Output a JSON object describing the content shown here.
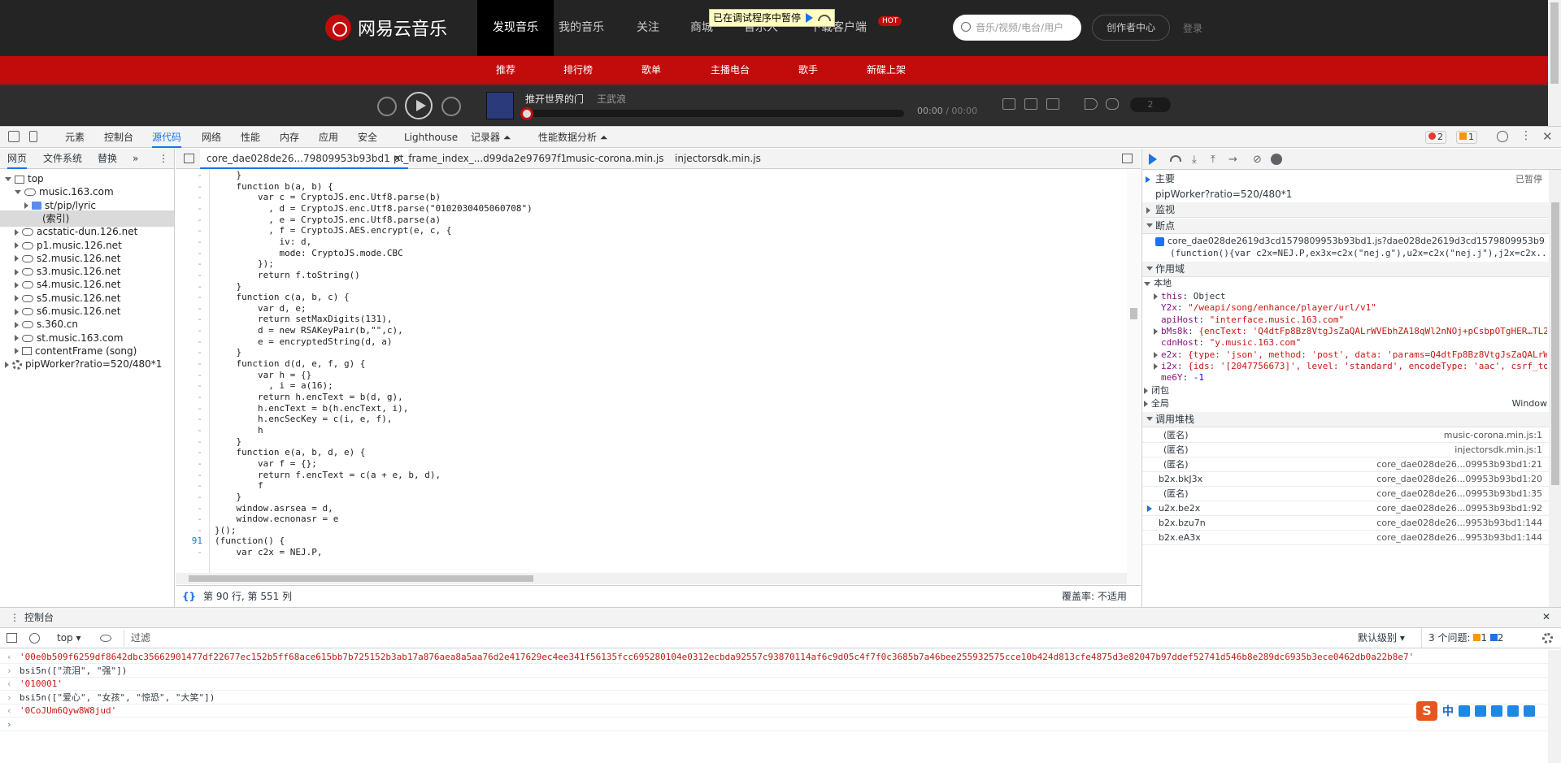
{
  "site": {
    "logo_text": "网易云音乐",
    "nav": [
      "发现音乐",
      "我的音乐",
      "关注",
      "商城",
      "音乐人",
      "下载客户端"
    ],
    "hot_badge": "HOT",
    "debugger_paused": "已在调试程序中暂停",
    "search_placeholder": "音乐/视频/电台/用户",
    "creator_center": "创作者中心",
    "login": "登录",
    "subnav": [
      "推荐",
      "排行榜",
      "歌单",
      "主播电台",
      "歌手",
      "新碟上架"
    ],
    "player": {
      "song": "推开世界的门",
      "artist": "王武浪",
      "time_current": "00:00",
      "time_total": "/ 00:00",
      "volume_count": "2",
      "progress_percent": 0
    }
  },
  "devtools": {
    "tabs": [
      "元素",
      "控制台",
      "源代码",
      "网络",
      "性能",
      "内存",
      "应用",
      "安全",
      "Lighthouse",
      "记录器 ⏶",
      "性能数据分析 ⏶"
    ],
    "errors": "2",
    "warnings": "1",
    "navigator_tabs": [
      "网页",
      "文件系统",
      "替换",
      "»"
    ],
    "tree": [
      {
        "label": "top",
        "icon": "frame-icon",
        "level": 0,
        "open": true
      },
      {
        "label": "music.163.com",
        "icon": "cloud-icon",
        "level": 1,
        "open": true
      },
      {
        "label": "st/pip/lyric",
        "icon": "folder-icon",
        "level": 2,
        "open": false
      },
      {
        "label": "(索引)",
        "icon": "file-icon",
        "level": 3,
        "selected": true
      },
      {
        "label": "acstatic-dun.126.net",
        "icon": "cloud-icon",
        "level": 1
      },
      {
        "label": "p1.music.126.net",
        "icon": "cloud-icon",
        "level": 1
      },
      {
        "label": "s2.music.126.net",
        "icon": "cloud-icon",
        "level": 1
      },
      {
        "label": "s3.music.126.net",
        "icon": "cloud-icon",
        "level": 1
      },
      {
        "label": "s4.music.126.net",
        "icon": "cloud-icon",
        "level": 1
      },
      {
        "label": "s5.music.126.net",
        "icon": "cloud-icon",
        "level": 1
      },
      {
        "label": "s6.music.126.net",
        "icon": "cloud-icon",
        "level": 1
      },
      {
        "label": "s.360.cn",
        "icon": "cloud-icon",
        "level": 1
      },
      {
        "label": "st.music.163.com",
        "icon": "cloud-icon",
        "level": 1
      },
      {
        "label": "contentFrame (song)",
        "icon": "frame-icon",
        "level": 1
      },
      {
        "label": "pipWorker?ratio=520/480*1",
        "icon": "gear-icon",
        "level": 0
      }
    ],
    "file_tabs": [
      "core_dae028de26...79809953b93bd1",
      "pt_frame_index_...d99da2e97697f1",
      "music-corona.min.js",
      "injectorsdk.min.js"
    ],
    "code_lines": [
      {
        "n": "-",
        "t": "    }"
      },
      {
        "n": "-",
        "t": "    function b(a, b) {"
      },
      {
        "n": "-",
        "t": "        var c = CryptoJS.enc.Utf8.parse(b)"
      },
      {
        "n": "-",
        "t": "          , d = CryptoJS.enc.Utf8.parse(\"0102030405060708\")"
      },
      {
        "n": "-",
        "t": "          , e = CryptoJS.enc.Utf8.parse(a)"
      },
      {
        "n": "-",
        "t": "          , f = CryptoJS.AES.encrypt(e, c, {"
      },
      {
        "n": "-",
        "t": "            iv: d,"
      },
      {
        "n": "-",
        "t": "            mode: CryptoJS.mode.CBC"
      },
      {
        "n": "-",
        "t": "        });"
      },
      {
        "n": "-",
        "t": "        return f.toString()"
      },
      {
        "n": "-",
        "t": "    }"
      },
      {
        "n": "-",
        "t": "    function c(a, b, c) {"
      },
      {
        "n": "-",
        "t": "        var d, e;"
      },
      {
        "n": "-",
        "t": "        return setMaxDigits(131),"
      },
      {
        "n": "-",
        "t": "        d = new RSAKeyPair(b,\"\",c),"
      },
      {
        "n": "-",
        "t": "        e = encryptedString(d, a)"
      },
      {
        "n": "-",
        "t": "    }"
      },
      {
        "n": "-",
        "t": "    function d(d, e, f, g) {"
      },
      {
        "n": "-",
        "t": "        var h = {}"
      },
      {
        "n": "-",
        "t": "          , i = a(16);"
      },
      {
        "n": "-",
        "t": "        return h.encText = b(d, g),"
      },
      {
        "n": "-",
        "t": "        h.encText = b(h.encText, i),"
      },
      {
        "n": "-",
        "t": "        h.encSecKey = c(i, e, f),"
      },
      {
        "n": "-",
        "t": "        h"
      },
      {
        "n": "-",
        "t": "    }"
      },
      {
        "n": "-",
        "t": "    function e(a, b, d, e) {"
      },
      {
        "n": "-",
        "t": "        var f = {};"
      },
      {
        "n": "-",
        "t": "        return f.encText = c(a + e, b, d),"
      },
      {
        "n": "-",
        "t": "        f"
      },
      {
        "n": "-",
        "t": "    }"
      },
      {
        "n": "-",
        "t": "    window.asrsea = d,"
      },
      {
        "n": "-",
        "t": "    window.ecnonasr = e"
      },
      {
        "n": "-",
        "t": "}();"
      },
      {
        "n": "91",
        "t": "(function() {"
      },
      {
        "n": "-",
        "t": "    var c2x = NEJ.P,"
      }
    ],
    "status_position": "第 90 行, 第 551 列",
    "coverage": "覆盖率: 不适用",
    "debugger": {
      "thread_main": "主要",
      "thread_status": "已暂停",
      "worker": "pipWorker?ratio=520/480*1",
      "watch": "监视",
      "breakpoints": "断点",
      "bp_file": "core_dae028de2619d3cd1579809953b93bd1.js?dae028de2619d3cd1579809953b93...",
      "bp_code": "(function(){var c2x=NEJ.P,ex3x=c2x(\"nej.g\"),u2x=c2x(\"nej.j\"),j2x=c2x...",
      "scope": "作用域",
      "local": "本地",
      "scope_vars": [
        {
          "k": "this",
          "v": "Object",
          "expandable": true,
          "plain": true
        },
        {
          "k": "Y2x",
          "v": "\"/weapi/song/enhance/player/url/v1\""
        },
        {
          "k": "apiHost",
          "v": "\"interface.music.163.com\""
        },
        {
          "k": "bMs8k",
          "v": "{encText: 'Q4dtFp8Bz8VtgJsZaQALrWVEbhZA18qWl2nNOj+pCsbpOTgHER…TL2",
          "expandable": true
        },
        {
          "k": "cdnHost",
          "v": "\"y.music.163.com\""
        },
        {
          "k": "e2x",
          "v": "{type: 'json', method: 'post', data: 'params=Q4dtFp8Bz8VtgJsZaQALrW",
          "expandable": true
        },
        {
          "k": "i2x",
          "v": "{ids: '[2047756673]', level: 'standard', encodeType: 'aac', csrf_to",
          "expandable": true
        },
        {
          "k": "me6Y",
          "v": "-1",
          "plain": true
        }
      ],
      "closure": "闭包",
      "global": "全局",
      "global_val": "Window",
      "callstack": "调用堆栈",
      "frames": [
        {
          "fn": "(匿名)",
          "loc": "music-corona.min.js:1"
        },
        {
          "fn": "(匿名)",
          "loc": "injectorsdk.min.js:1"
        },
        {
          "fn": "(匿名)",
          "loc": "core_dae028de26...09953b93bd1:21"
        },
        {
          "fn": "b2x.bkJ3x",
          "loc": "core_dae028de26...09953b93bd1:20"
        },
        {
          "fn": "(匿名)",
          "loc": "core_dae028de26...09953b93bd1:35"
        },
        {
          "fn": "u2x.be2x",
          "loc": "core_dae028de26...09953b93bd1:92",
          "current": true
        },
        {
          "fn": "b2x.bzu7n",
          "loc": "core_dae028de26...9953b93bd1:144"
        },
        {
          "fn": "b2x.eA3x",
          "loc": "core_dae028de26...9953b93bd1:144"
        }
      ]
    },
    "console": {
      "drawer_title": "控制台",
      "context": "top ▾",
      "filter_placeholder": "过滤",
      "levels": "默认级别 ▾",
      "issues": "3 个问题:",
      "issues_warn": "1",
      "issues_info": "2",
      "lines": [
        {
          "kind": "res",
          "text": "'00e0b509f6259df8642dbc35662901477df22677ec152b5ff68ace615bb7b725152b3ab17a876aea8a5aa76d2e417629ec4ee341f56135fcc695280104e0312ecbda92557c93870114af6c9d05c4f7f0c3685b7a46bee255932575cce10b424d813cfe4875d3e82047b97ddef52741d546b8e289dc6935b3ece0462db0a22b8e7'"
        },
        {
          "kind": "in",
          "text": "bsi5n([\"流泪\", \"强\"])"
        },
        {
          "kind": "res",
          "text": "'010001'"
        },
        {
          "kind": "in",
          "text": "bsi5n([\"爱心\", \"女孩\", \"惊恐\", \"大笑\"])"
        },
        {
          "kind": "res",
          "text": "'0CoJUm6Qyw8W8jud'"
        },
        {
          "kind": "prompt",
          "text": ""
        }
      ]
    },
    "ime": "中"
  }
}
